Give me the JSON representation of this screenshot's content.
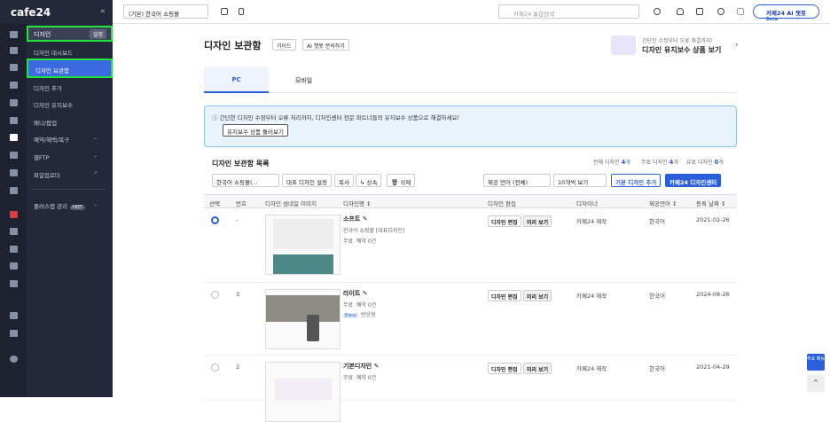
{
  "app": {
    "logo": "cafe24",
    "collapse": "«"
  },
  "sidebar": {
    "section": "디자인",
    "settings": "설정",
    "hot": "HOT",
    "items": [
      {
        "label": "디자인 대시보드"
      },
      {
        "label": "디자인 보관함"
      },
      {
        "label": "디자인 추가"
      },
      {
        "label": "디자인 유지보수"
      },
      {
        "label": "배너/팝업"
      },
      {
        "label": "예약/혜택/복구"
      },
      {
        "label": "웹FTP"
      },
      {
        "label": "파일업로더"
      },
      {
        "label": "플러스앱 관리"
      }
    ]
  },
  "topbar": {
    "shop": "(기본) 한국어 쇼핑몰",
    "search_placeholder": "카페24 통합검색",
    "ai_label": "카페24 AI 챗봇",
    "beta": "Beta"
  },
  "page": {
    "title": "디자인 보관함",
    "guide": "가이드",
    "ai_ask": "AI 챗봇 문의하기",
    "promo_sub": "간단한 수정부터 오류 해결까지!",
    "promo_main": "디자인 유지보수 상품 보기",
    "promo_arrow": "›"
  },
  "tabs": [
    {
      "label": "PC"
    },
    {
      "label": "모바일"
    }
  ],
  "info": {
    "text": "간단한 디자인 수정부터 오류 처리까지, 디자인센터 전문 파트너들의 유지보수 상품으로 해결하세요!",
    "button": "유지보수 상품 둘러보기"
  },
  "list": {
    "title": "디자인 보관함 목록",
    "total_label": "전체 디자인",
    "total": "4",
    "total_unit": "개",
    "free_label": "무료 디자인",
    "free": "4",
    "free_unit": "개",
    "paid_label": "유료 디자인",
    "paid": "0",
    "paid_unit": "개",
    "lang_select": "한국어 쇼핑몰(...",
    "set_rep": "대표 디자인 설정",
    "copy": "복사",
    "inherit": "상속",
    "delete": "삭제",
    "lang_filter": "제공 언어 (전체)",
    "per_page": "10개씩 보기",
    "add_basic": "기본 디자인 추가",
    "center": "카페24 디자인센터"
  },
  "columns": [
    "선택",
    "번호",
    "디자인 섬네일 이미지",
    "디자인명 ↕",
    "디자인 편집",
    "디자이너",
    "제공언어 ↕",
    "등록 날짜 ↕"
  ],
  "rows": [
    {
      "num": "-",
      "name": "소프트",
      "flag": "한국어 쇼핑몰 [대표디자인]",
      "free": "무료",
      "reserve": "예약 0건",
      "easy": "",
      "resp": "",
      "edit": "디자인 편집",
      "preview": "미리 보기",
      "designer": "카페24 제작",
      "lang": "한국어",
      "date": "2021-02-26",
      "selected": true
    },
    {
      "num": "3",
      "name": "라이트",
      "flag": "",
      "free": "무료",
      "reserve": "예약 0건",
      "easy": "Easy",
      "resp": "반응형",
      "edit": "디자인 편집",
      "preview": "미리 보기",
      "designer": "카페24 제작",
      "lang": "한국어",
      "date": "2024-08-26",
      "selected": false
    },
    {
      "num": "2",
      "name": "기본디자인",
      "flag": "",
      "free": "무료",
      "reserve": "예약 0건",
      "easy": "",
      "resp": "",
      "edit": "디자인 편집",
      "preview": "미리 보기",
      "designer": "카페24 제작",
      "lang": "한국어",
      "date": "2021-04-29",
      "selected": false
    }
  ],
  "fab": {
    "label": "주요 메뉴",
    "top": "^"
  }
}
